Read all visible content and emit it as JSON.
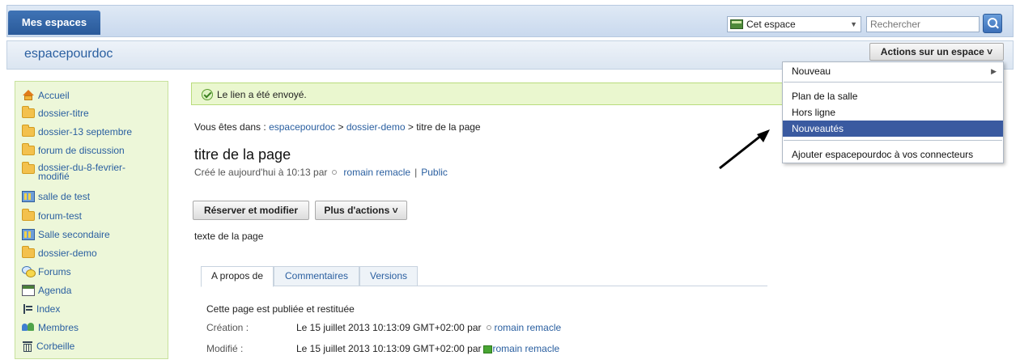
{
  "topbar": {
    "my_spaces_label": "Mes espaces",
    "scope_value": "Cet espace",
    "search_placeholder": "Rechercher"
  },
  "space": {
    "title": "espacepourdoc",
    "actions_label": "Actions sur un espace ˅"
  },
  "sidebar": {
    "items": [
      {
        "label": "Accueil",
        "icon": "home-icon"
      },
      {
        "label": "dossier-titre",
        "icon": "folder-icon"
      },
      {
        "label": "dossier-13 septembre",
        "icon": "folder-icon"
      },
      {
        "label": "forum de discussion",
        "icon": "folder-icon"
      },
      {
        "label": "dossier-du-8-fevrier-\nmodifié",
        "icon": "folder-icon"
      },
      {
        "label": "salle de test",
        "icon": "room-icon"
      },
      {
        "label": "forum-test",
        "icon": "folder-icon"
      },
      {
        "label": "Salle secondaire",
        "icon": "room-icon"
      },
      {
        "label": "dossier-demo",
        "icon": "folder-icon"
      },
      {
        "label": "Forums",
        "icon": "forums-icon"
      },
      {
        "label": "Agenda",
        "icon": "agenda-icon"
      },
      {
        "label": "Index",
        "icon": "index-icon"
      },
      {
        "label": "Membres",
        "icon": "members-icon"
      },
      {
        "label": "Corbeille",
        "icon": "trash-icon"
      }
    ]
  },
  "notice": {
    "text": "Le lien a été envoyé."
  },
  "breadcrumb": {
    "prefix": "Vous êtes dans : ",
    "level1": "espacepourdoc",
    "sep": " > ",
    "level2": "dossier-demo",
    "current": "titre de la page"
  },
  "page": {
    "title": "titre de la page",
    "created_prefix": "Créé le aujourd'hui à 10:13 par",
    "author": "romain remacle",
    "separator": "|",
    "visibility": "Public",
    "body": "texte de la page"
  },
  "buttons": {
    "reserve_edit": "Réserver et modifier",
    "more_actions": "Plus d'actions ˅"
  },
  "tabs": [
    {
      "label": "A propos de"
    },
    {
      "label": "Commentaires"
    },
    {
      "label": "Versions"
    }
  ],
  "about": {
    "status": "Cette page est publiée et restituée",
    "created_label": "Création :",
    "created_value": "Le 15 juillet 2013 10:13:09 GMT+02:00 par",
    "created_by": "romain remacle",
    "modified_label": "Modifié :",
    "modified_value": "Le 15 juillet 2013 10:13:09 GMT+02:00 par",
    "modified_by": "romain remacle"
  },
  "menu": {
    "items": [
      {
        "label": "Nouveau"
      },
      {
        "label": "Plan de la salle"
      },
      {
        "label": "Hors ligne"
      },
      {
        "label": "Nouveautés"
      },
      {
        "label": "Ajouter espacepourdoc à vos connecteurs"
      }
    ]
  },
  "colors": {
    "accent": "#2a5fa0",
    "sidebar_bg": "#edf7d9",
    "notice_bg": "#eaf7cf",
    "menu_selected": "#3a5aa0"
  }
}
